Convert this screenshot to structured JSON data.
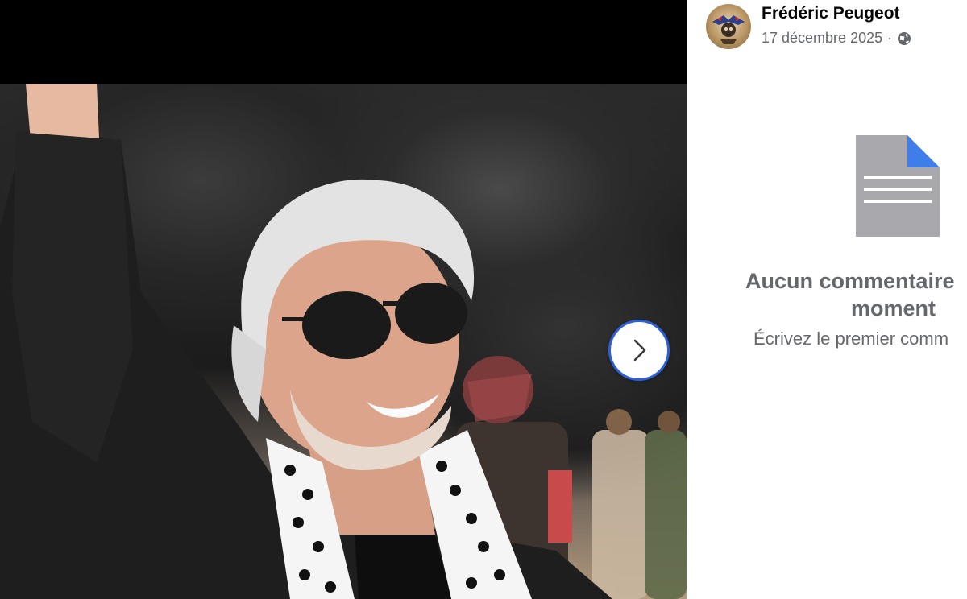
{
  "post": {
    "author_name": "Frédéric Peugeot",
    "date": "17 décembre 2025",
    "separator": "·",
    "visibility_icon": "globe-icon"
  },
  "viewer": {
    "next_icon": "chevron-right-icon",
    "accent_color": "#2d5fd8"
  },
  "comments": {
    "empty_title_line1": "Aucun commentaire",
    "empty_title_line2": "moment",
    "empty_subtitle": "Écrivez le premier comm",
    "empty_icon": "document-icon"
  }
}
